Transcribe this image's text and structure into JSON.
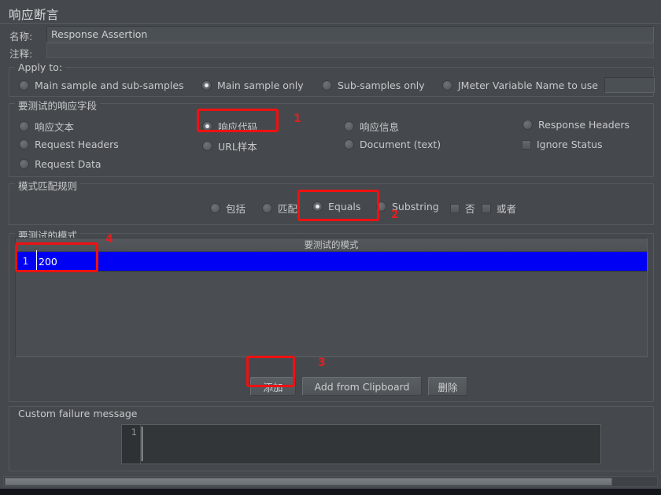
{
  "panel": {
    "title": "响应断言"
  },
  "fields": {
    "name_label": "名称:",
    "name_value": "Response Assertion",
    "comment_label": "注释:",
    "comment_value": ""
  },
  "apply_to": {
    "legend": "Apply to:",
    "options": [
      {
        "label": "Main sample and sub-samples",
        "selected": false
      },
      {
        "label": "Main sample only",
        "selected": true
      },
      {
        "label": "Sub-samples only",
        "selected": false
      },
      {
        "label": "JMeter Variable Name to use",
        "selected": false
      }
    ],
    "variable_value": ""
  },
  "response_field": {
    "legend": "要测试的响应字段",
    "options": [
      {
        "label": "响应文本",
        "selected": false
      },
      {
        "label": "响应代码",
        "selected": true
      },
      {
        "label": "响应信息",
        "selected": false
      },
      {
        "label": "Response Headers",
        "selected": false
      },
      {
        "label": "Request Headers",
        "selected": false
      },
      {
        "label": "URL样本",
        "selected": false
      },
      {
        "label": "Document (text)",
        "selected": false
      },
      {
        "label": "Request Data",
        "selected": false
      }
    ],
    "ignore_status": {
      "label": "Ignore Status",
      "checked": false
    }
  },
  "pattern_rules": {
    "legend": "模式匹配规则",
    "options": [
      {
        "label": "包括",
        "selected": false
      },
      {
        "label": "匹配",
        "selected": false
      },
      {
        "label": "Equals",
        "selected": true
      },
      {
        "label": "Substring",
        "selected": false
      }
    ],
    "checkboxes": [
      {
        "label": "否",
        "checked": false
      },
      {
        "label": "或者",
        "checked": false
      }
    ]
  },
  "patterns": {
    "legend": "要测试的模式",
    "column_header": "要测试的模式",
    "rows": [
      {
        "num": "1",
        "value": "200"
      }
    ],
    "buttons": {
      "add": "添加",
      "add_from_clipboard": "Add from Clipboard",
      "delete": "删除"
    }
  },
  "custom_failure": {
    "legend": "Custom failure message",
    "line_number": "1",
    "value": ""
  },
  "annotations": [
    {
      "number": "1"
    },
    {
      "number": "2"
    },
    {
      "number": "3"
    },
    {
      "number": "4"
    }
  ],
  "colors": {
    "selection_blue": "#0000f4",
    "annotation_red": "#ee1111",
    "panel_bg": "#45494d"
  }
}
